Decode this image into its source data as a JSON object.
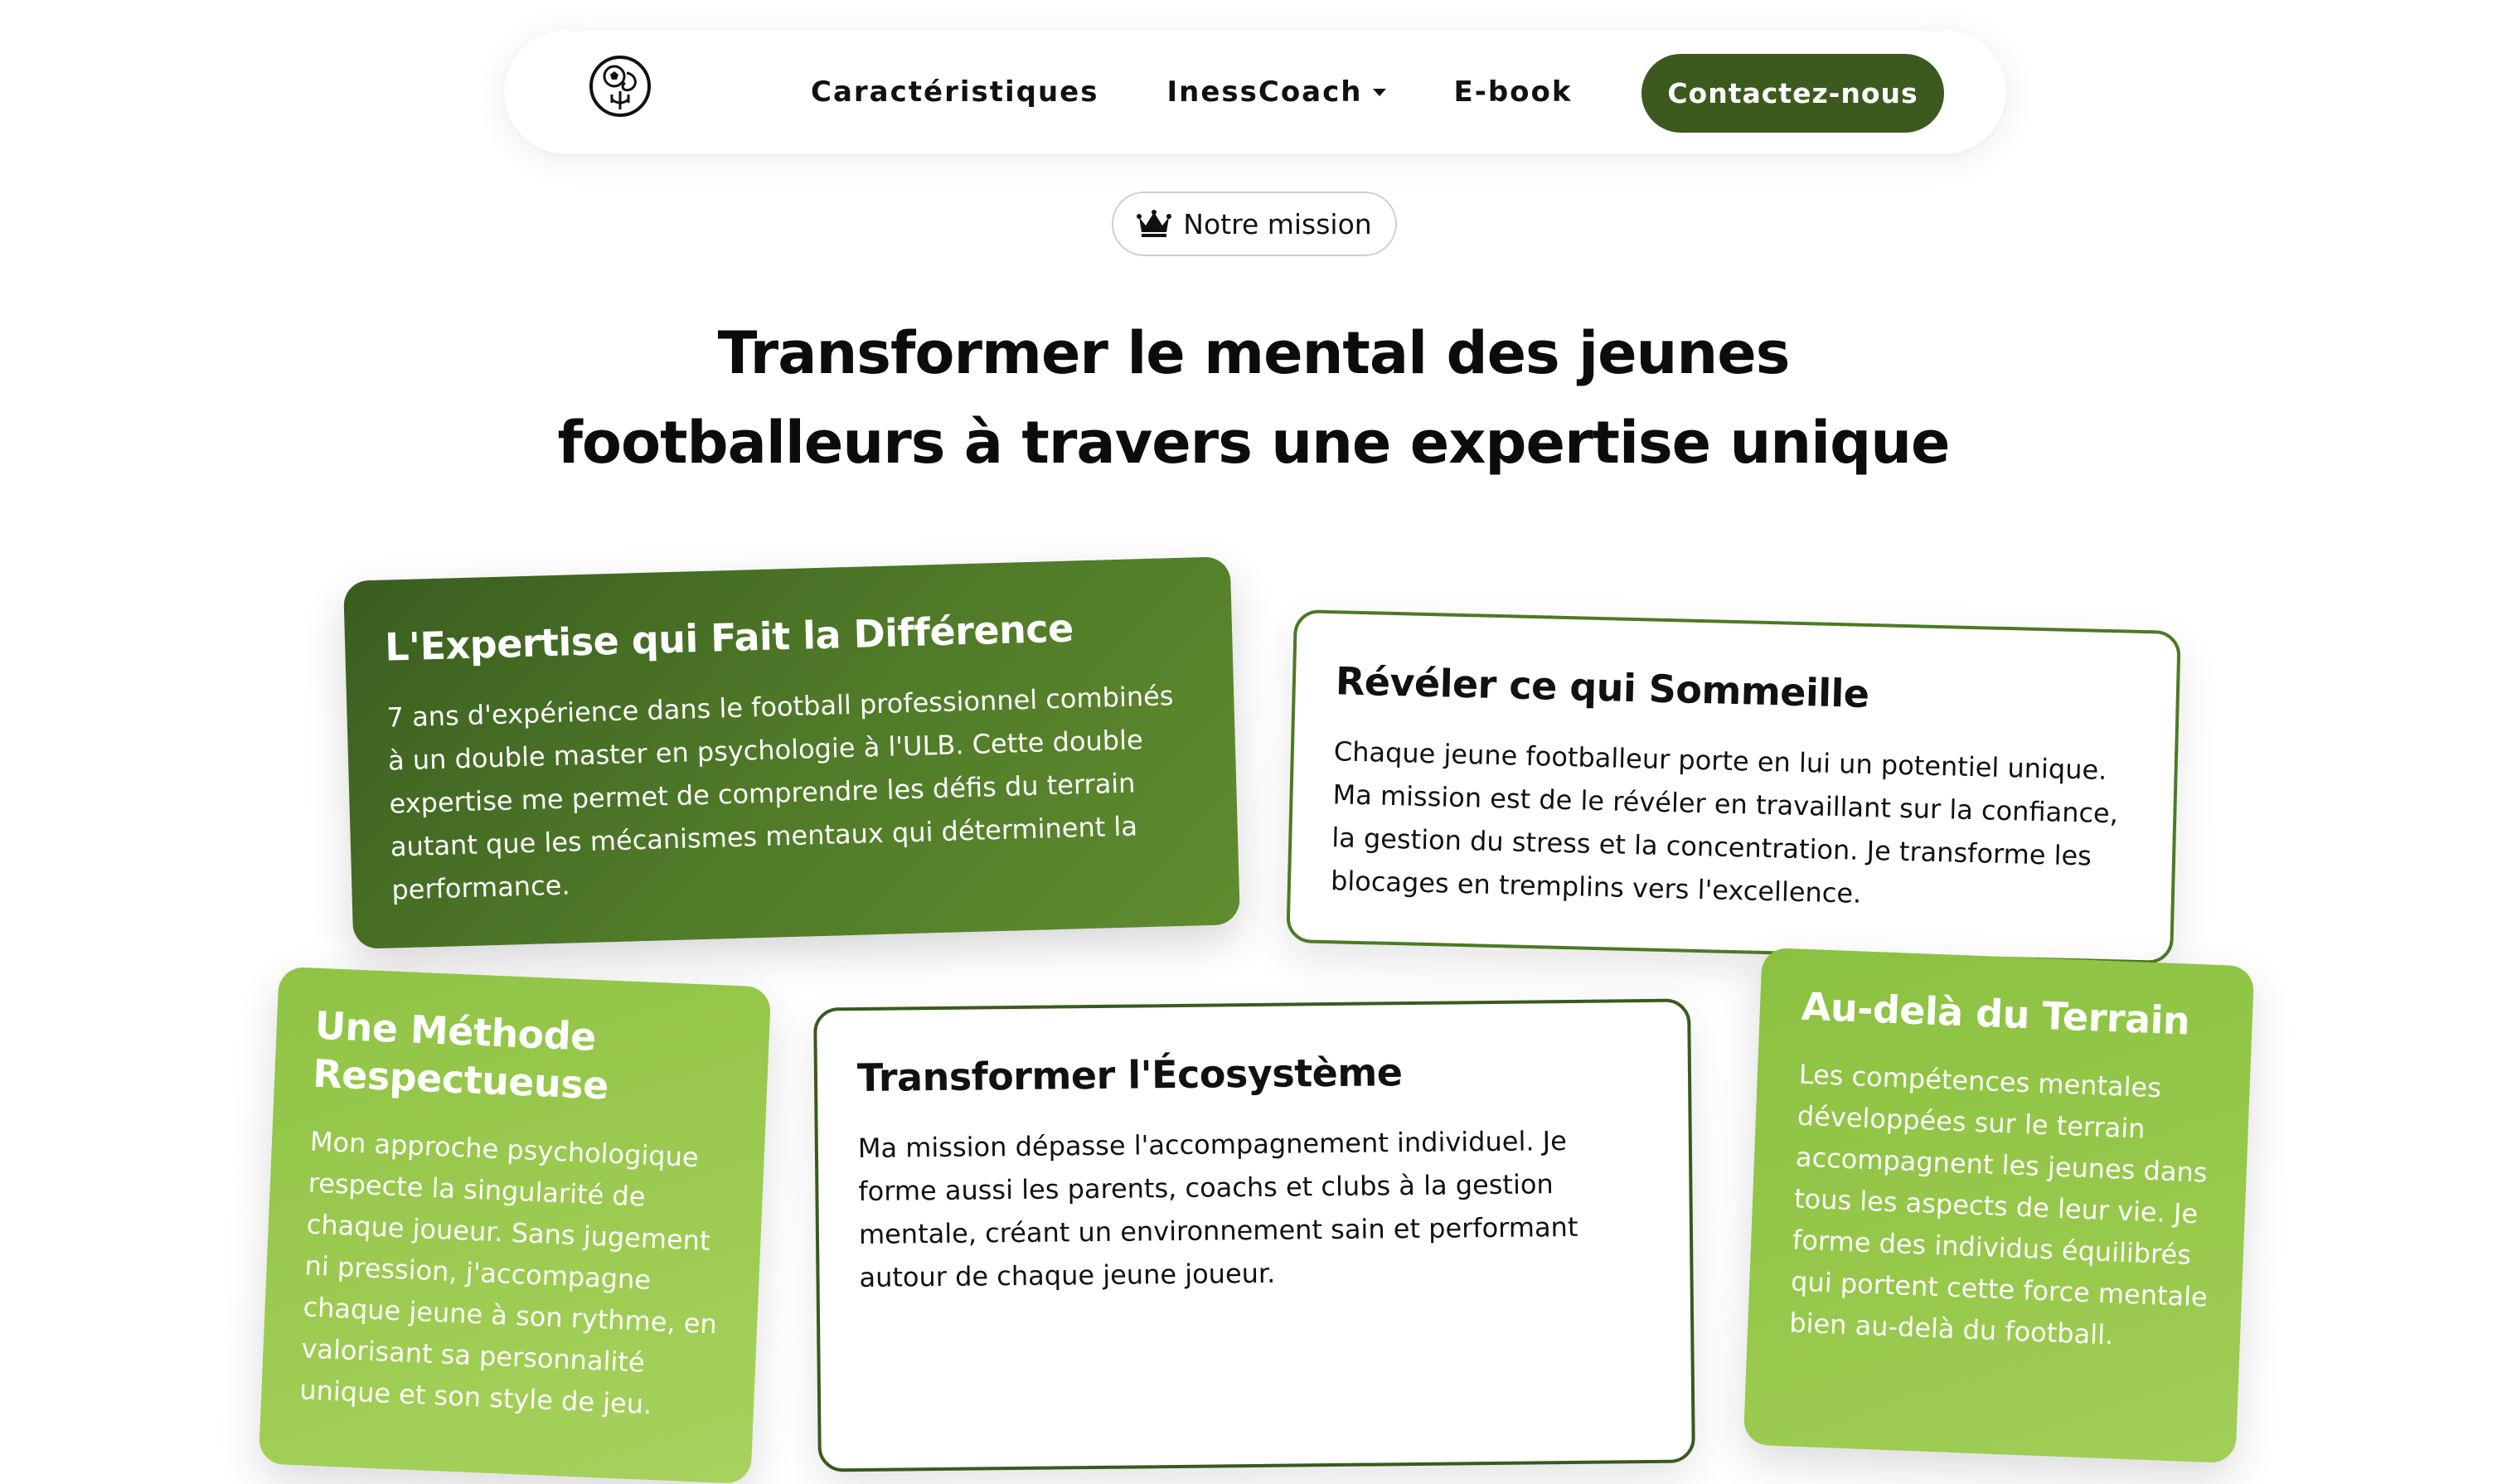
{
  "navbar": {
    "logo_icon": "brain-football-logo-icon",
    "links": [
      {
        "label": "Caractéristiques"
      },
      {
        "label": "InessCoach",
        "has_dropdown": true
      },
      {
        "label": "E-book"
      }
    ],
    "cta_label": "Contactez-nous"
  },
  "mission_badge": {
    "icon": "crown-icon",
    "label": "Notre mission"
  },
  "headline": {
    "line1": "Transformer le mental des jeunes",
    "line2": "footballeurs à travers une expertise unique"
  },
  "cards": [
    {
      "title": "L'Expertise qui Fait la Différence",
      "text": "7 ans d'expérience dans le football professionnel combinés à un double master en psychologie à l'ULB. Cette double expertise me permet de comprendre les défis du terrain autant que les mécanismes mentaux qui déterminent la performance."
    },
    {
      "title": "Révéler ce qui Sommeille",
      "text": "Chaque jeune footballeur porte en lui un potentiel unique. Ma mission est de le révéler en travaillant sur la confiance, la gestion du stress et la concentration. Je transforme les blocages en tremplins vers l'excellence."
    },
    {
      "title": "Une Méthode Respectueuse",
      "text": "Mon approche psychologique respecte la singularité de chaque joueur. Sans jugement ni pression, j'accompagne chaque jeune à son rythme, en valorisant sa personnalité unique et son style de jeu."
    },
    {
      "title": "Transformer l'Écosystème",
      "text": "Ma mission dépasse l'accompagnement individuel. Je forme aussi les parents, coachs et clubs à la gestion mentale, créant un environnement sain et performant autour de chaque jeune joueur."
    },
    {
      "title": "Au-delà du Terrain",
      "text": "Les compétences mentales développées sur le terrain accompagnent les jeunes dans tous les aspects de leur vie. Je forme des individus équilibrés qui portent cette force mentale bien au-delà du football."
    }
  ],
  "colors": {
    "brand_dark_green": "#3d5a1e",
    "brand_light_green": "#9ccb50"
  }
}
